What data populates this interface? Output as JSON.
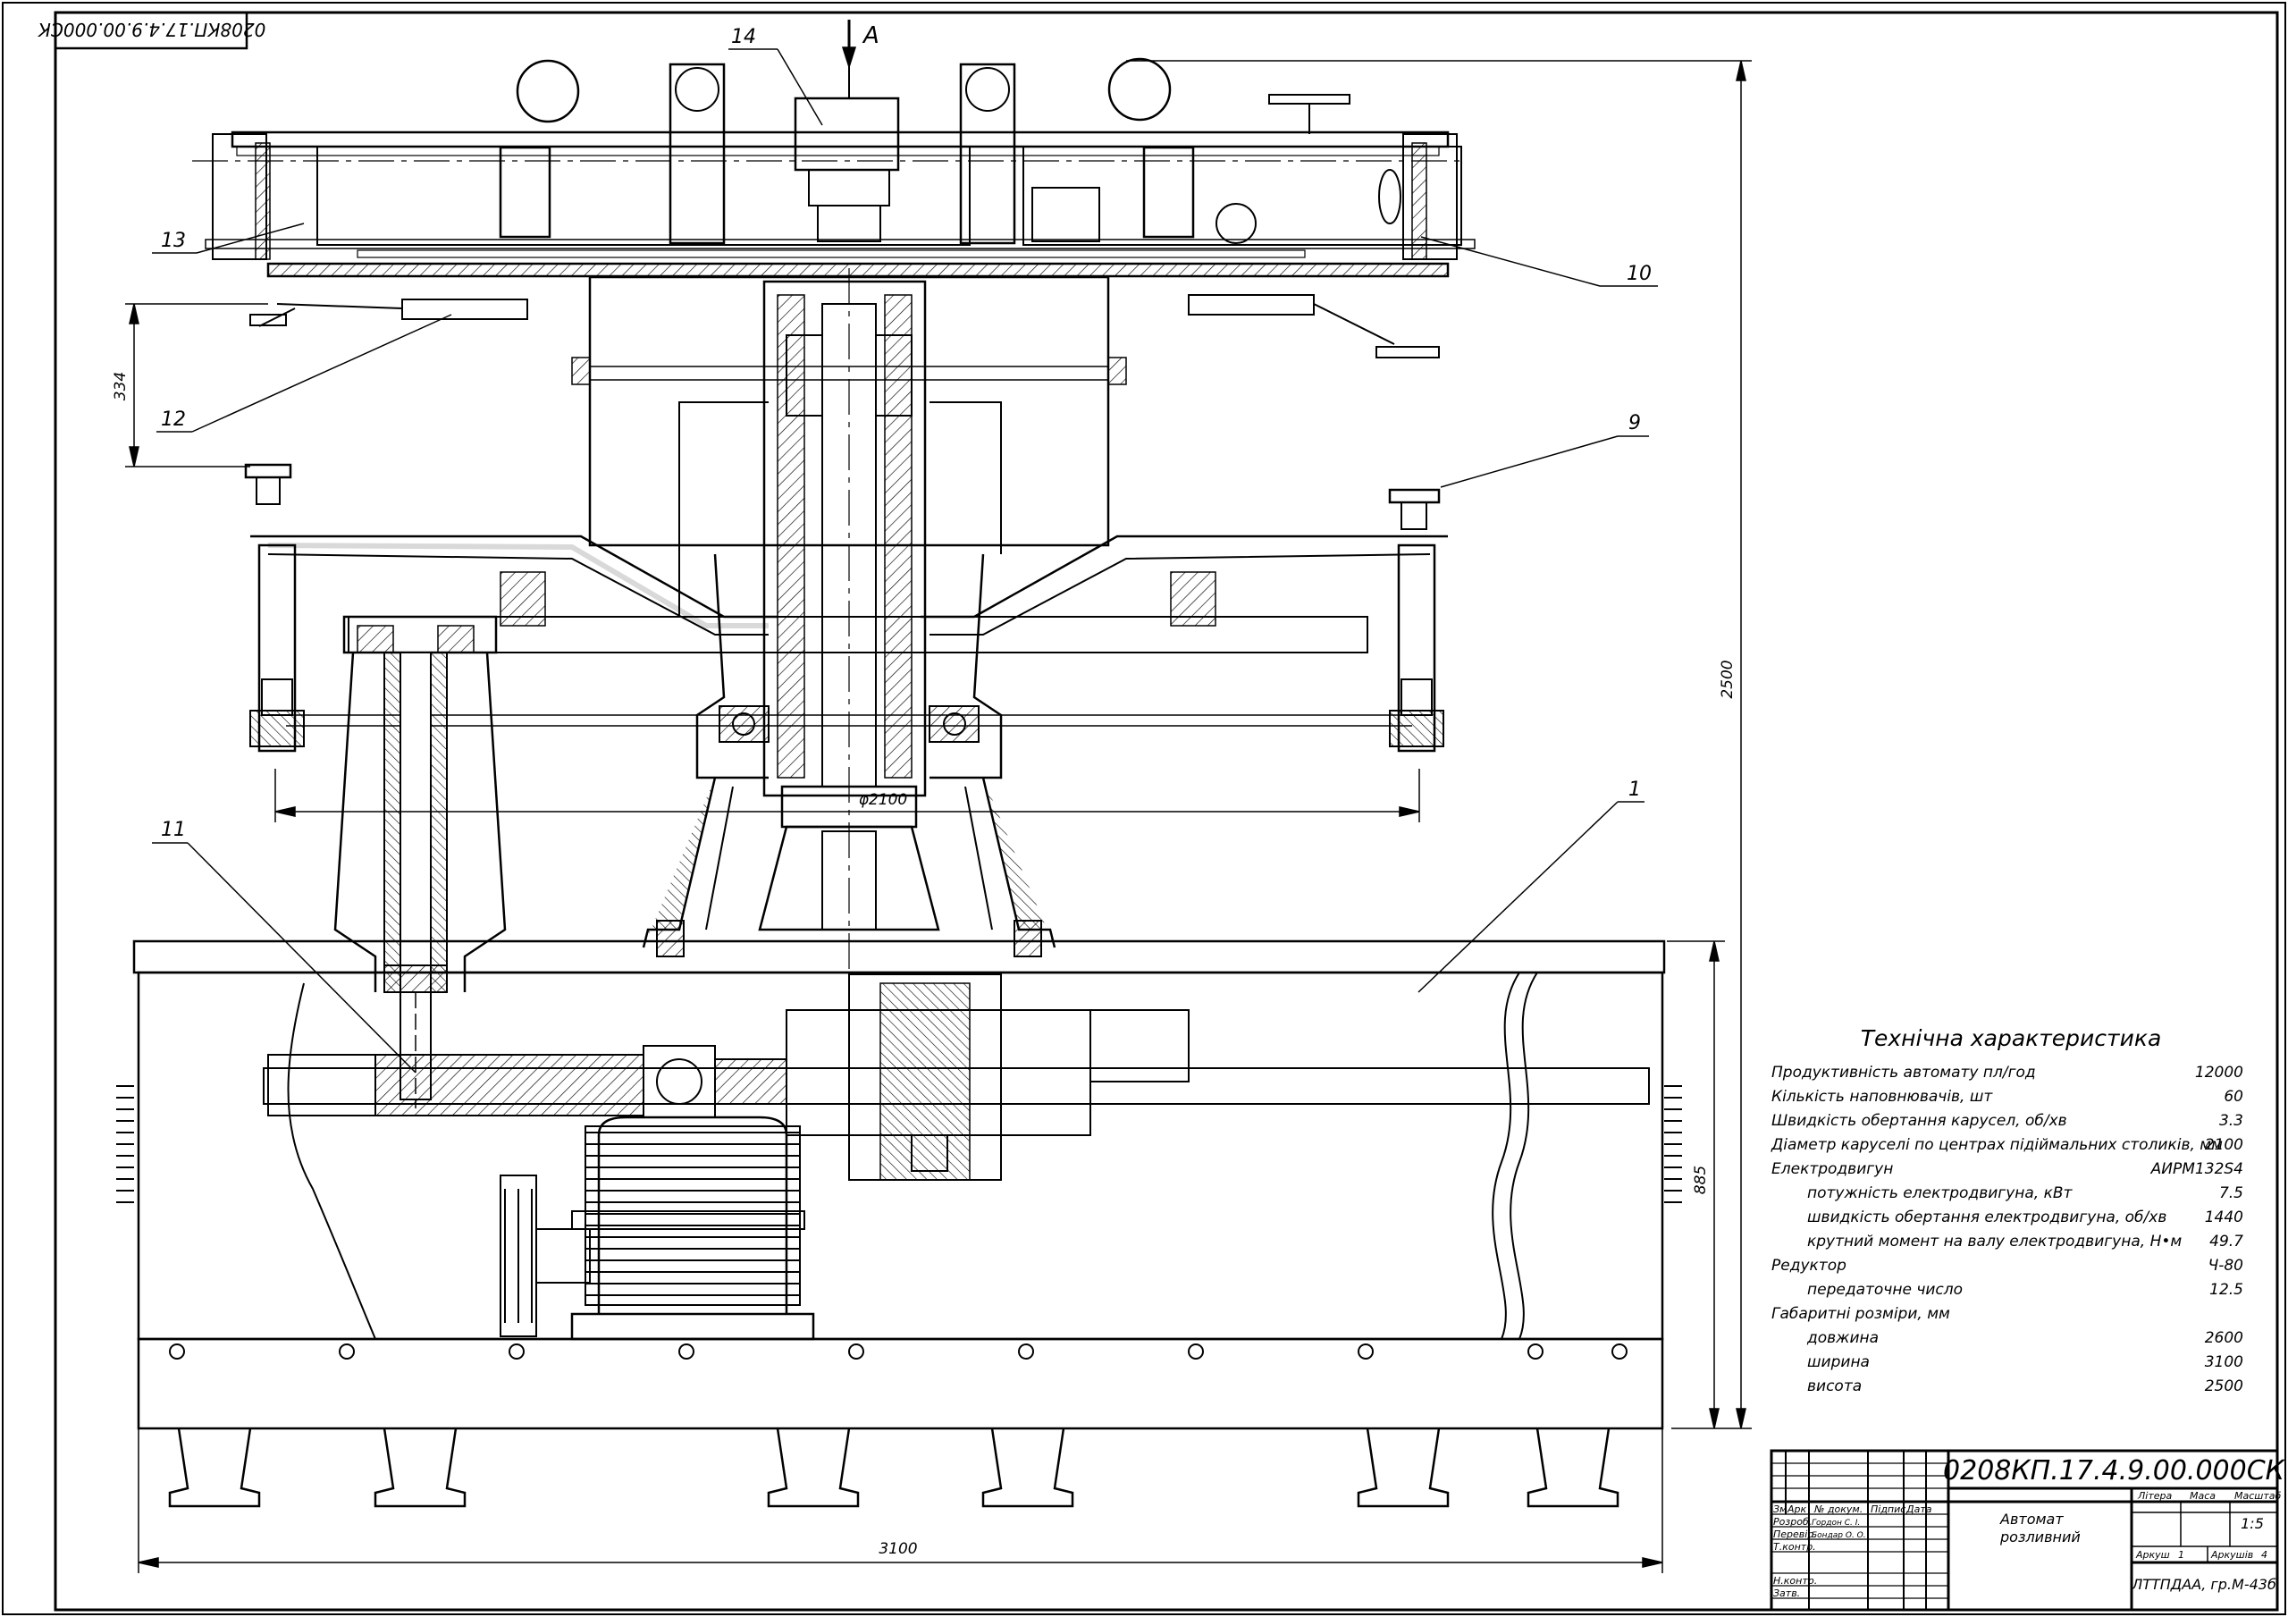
{
  "drawing": {
    "code": "0208КП.17.4.9.00.000СК",
    "corner_code": "0208КП.17.4.9.00.000СК",
    "view_label": "А",
    "dimensions": {
      "width_overall": "3100",
      "height_overall": "2500",
      "carousel_diameter": "φ2100",
      "base_height": "885",
      "lift_height": "334"
    },
    "callouts": [
      "1",
      "9",
      "10",
      "11",
      "12",
      "13",
      "14"
    ]
  },
  "technical": {
    "title": "Технічна характеристика",
    "rows": [
      {
        "label": "Продуктивність автомату пл/год",
        "value": "12000",
        "indent": false
      },
      {
        "label": "Кількість наповнювачів, шт",
        "value": "60",
        "indent": false
      },
      {
        "label": "Швидкість обертання карусел, об/хв",
        "value": "3.3",
        "indent": false
      },
      {
        "label": "Діаметр каруселі по центрах підіймальних столиків, мм",
        "value": "2100",
        "indent": false
      },
      {
        "label": "Електродвигун",
        "value": "АИРМ132S4",
        "indent": false
      },
      {
        "label": "потужність електродвигуна, кВт",
        "value": "7.5",
        "indent": true
      },
      {
        "label": "швидкість обертання електродвигуна, об/хв",
        "value": "1440",
        "indent": true
      },
      {
        "label": "крутний момент на валу електродвигуна, Н•м",
        "value": "49.7",
        "indent": true
      },
      {
        "label": "Редуктор",
        "value": "Ч-80",
        "indent": false
      },
      {
        "label": "передаточне число",
        "value": "12.5",
        "indent": true
      },
      {
        "label": "Габаритні розміри, мм",
        "value": "",
        "indent": false
      },
      {
        "label": "довжина",
        "value": "2600",
        "indent": true
      },
      {
        "label": "ширина",
        "value": "3100",
        "indent": true
      },
      {
        "label": "висота",
        "value": "2500",
        "indent": true
      }
    ]
  },
  "title_block": {
    "name_line1": "Автомат",
    "name_line2": "розливний",
    "headers": {
      "change": "Зм",
      "sheet": "Арк",
      "doc_no": "№ докум.",
      "sign": "Підпис",
      "date": "Дата"
    },
    "roles": {
      "developed": "Розроб.",
      "checked": "Перевір.",
      "tcontrol": "Т.контр.",
      "ncontrol": "Н.контр.",
      "approved": "Затв."
    },
    "developer": "Гордон С. І.",
    "checker": "Бондар О. О.",
    "litera": "Літера",
    "mass": "Маса",
    "scale_label": "Масштаб",
    "scale": "1:5",
    "sheet_label": "Аркуш",
    "sheet_no": "1",
    "sheets_label": "Аркушів",
    "sheets_total": "4",
    "org": "ЛТТПДАА, гр.М-43б"
  }
}
